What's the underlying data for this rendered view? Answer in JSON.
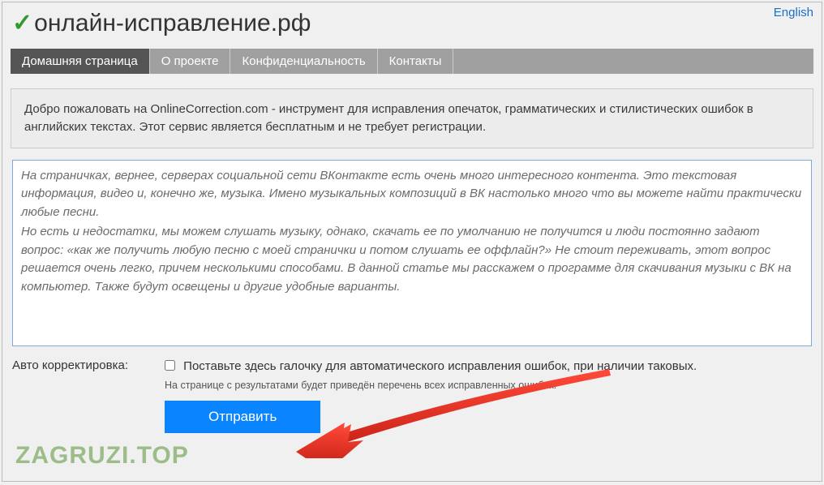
{
  "lang_link": "English",
  "site_title": "онлайн-исправление.рф",
  "nav": {
    "items": [
      {
        "label": "Домашняя страница",
        "active": true
      },
      {
        "label": "О проекте",
        "active": false
      },
      {
        "label": "Конфиденциальность",
        "active": false
      },
      {
        "label": "Контакты",
        "active": false
      }
    ]
  },
  "intro": "Добро пожаловать на OnlineCorrection.com - инструмент для исправления опечаток, грамматических и стилистических ошибок в английских текстах. Этот сервис является бесплатным и не требует регистрации.",
  "text_content": {
    "p1": "На страничках, вернее, серверах социальной сети ВКонтакте есть очень много интересного контента. Это текстовая информация, видео и, конечно же, музыка. Имено музыкальных композиций в ВК настолько много что вы можете найти практически любые песни.",
    "p2": "Но есть и недостатки, мы можем слушать музыку, однако, скачать ее по умолчанию не получится и люди постоянно задают вопрос: «как же получить любую песню с моей странички и потом слушать ее оффлайн?» Не стоит переживать, этот вопрос решается очень легко, причем несколькими способами. В данной статье мы расскажем о программе для скачивания музыки с ВК на компьютер. Также будут освещены и другие удобные варианты."
  },
  "auto": {
    "label": "Авто корректировка:",
    "desc": "Поставьте здесь галочку для автоматического исправления ошибок, при наличии таковых.",
    "hint": "На странице с результатами будет приведён перечень всех исправленных ошибок."
  },
  "submit_label": "Отправить",
  "watermark": "ZAGRUZI.TOP"
}
